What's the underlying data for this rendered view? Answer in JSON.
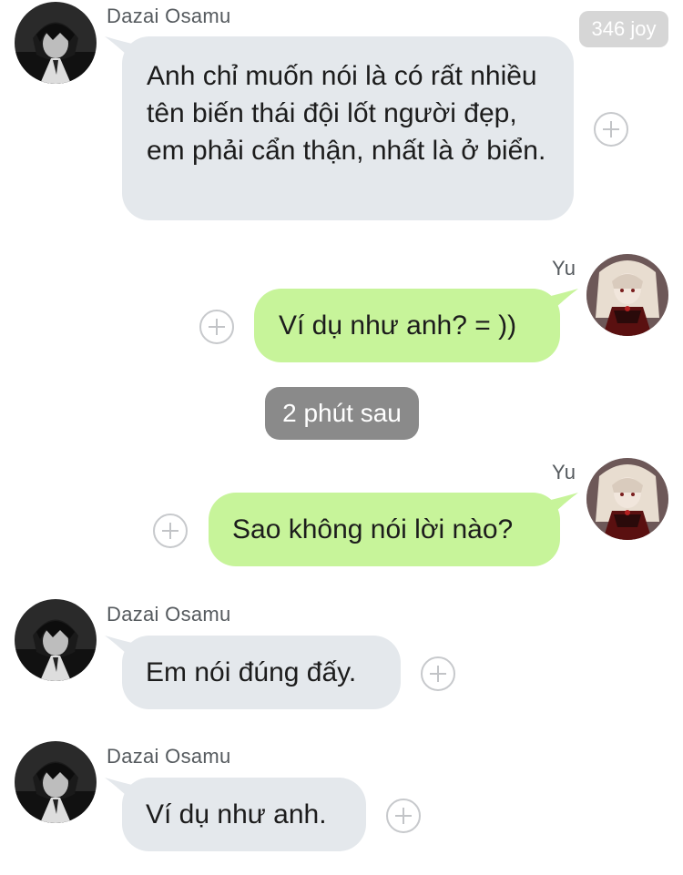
{
  "badge": {
    "text": "346 joy"
  },
  "messages": [
    {
      "sender": "Dazai Osamu",
      "text": "Anh chỉ muốn nói là có rất nhiều tên biến thái đội lốt người đẹp, em phải cẩn thận, nhất là ở biển."
    },
    {
      "sender": "Yu",
      "text": "Ví dụ như anh? = ))"
    },
    {
      "sender": "Yu",
      "text": "Sao không nói lời nào?"
    },
    {
      "sender": "Dazai Osamu",
      "text": "Em nói đúng đấy."
    },
    {
      "sender": "Dazai Osamu",
      "text": "Ví dụ như anh."
    }
  ],
  "separator": {
    "text": "2 phút sau"
  },
  "colors": {
    "incoming_bubble": "#e4e8ec",
    "outgoing_bubble": "#c7f49a",
    "time_chip": "#8a8a8a"
  }
}
